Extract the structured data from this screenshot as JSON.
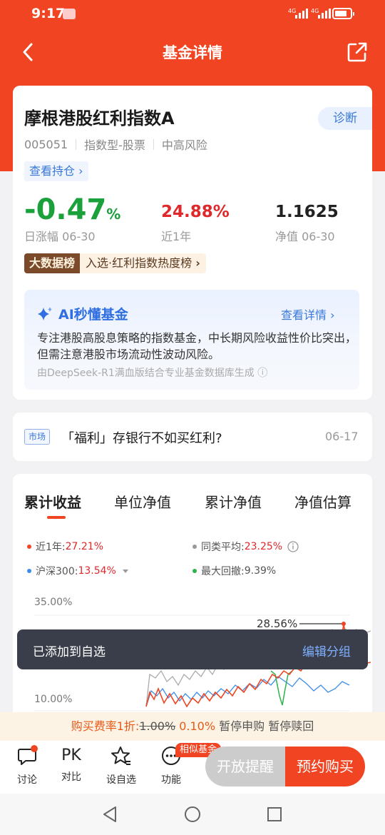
{
  "status_bar": {
    "time": "9:17",
    "net1": "4G",
    "net2": "4G"
  },
  "nav": {
    "title": "基金详情"
  },
  "fund": {
    "name": "摩根港股红利指数A",
    "diagnose_label": "诊断",
    "code": "005051",
    "type": "指数型-股票",
    "risk": "中高风险",
    "holdings_label": "查看持仓 ›",
    "day_change": "-0.47",
    "day_change_unit": "%",
    "day_change_label": "日涨幅 06-30",
    "year_return": "24.88%",
    "year_return_label": "近1年",
    "nav_value": "1.1625",
    "nav_label": "净值 06-30",
    "bigdata_tag": "大数据榜",
    "bigdata_text": "入选·红利指数热度榜",
    "bigdata_arrow": "›"
  },
  "ai": {
    "title": "AI秒懂基金",
    "detail_label": "查看详情 ›",
    "text": "专注港股高股息策略的指数基金，中长期风险收益性价比突出，但需注意港股市场流动性波动风险。",
    "source": "由DeepSeek-R1满血版结合专业基金数据库生成 ⓘ"
  },
  "news": {
    "tag": "市场",
    "text": "「福利」存银行不如买红利?",
    "date": "06-17"
  },
  "tabs": [
    "累计收益",
    "单位净值",
    "累计净值",
    "净值估算"
  ],
  "legend": {
    "fund_label": "近1年:",
    "fund_value": "27.21%",
    "avg_label": "同类平均:",
    "avg_value": "23.25%",
    "index_label": "沪深300:",
    "index_value": "13.54%",
    "drawdown_label": "最大回撤:",
    "drawdown_value": "9.39%"
  },
  "chart_data": {
    "type": "line",
    "y_ticks": [
      "35.00%",
      "10.00%"
    ],
    "peak_label": "28.56%",
    "series": [
      {
        "name": "近1年",
        "color": "#f04422"
      },
      {
        "name": "同类平均",
        "color": "#999999"
      },
      {
        "name": "沪深300",
        "color": "#3a8de8"
      }
    ]
  },
  "toast": {
    "message": "已添加到自选",
    "action": "编辑分组"
  },
  "fee": {
    "prefix": "购买费率1折:",
    "original": "1.00%",
    "discounted": "0.10%",
    "status": "暂停申购 暂停赎回"
  },
  "bottom": {
    "discuss": "讨论",
    "compare_icon": "PK",
    "compare": "对比",
    "watchlist": "设自选",
    "features": "功能",
    "similar_badge": "相似基金",
    "remind": "开放提醒",
    "buy": "预约购买"
  },
  "colors": {
    "brand": "#f04422",
    "up": "#e0282b",
    "down": "#1aa13c",
    "link": "#3a78d8"
  }
}
